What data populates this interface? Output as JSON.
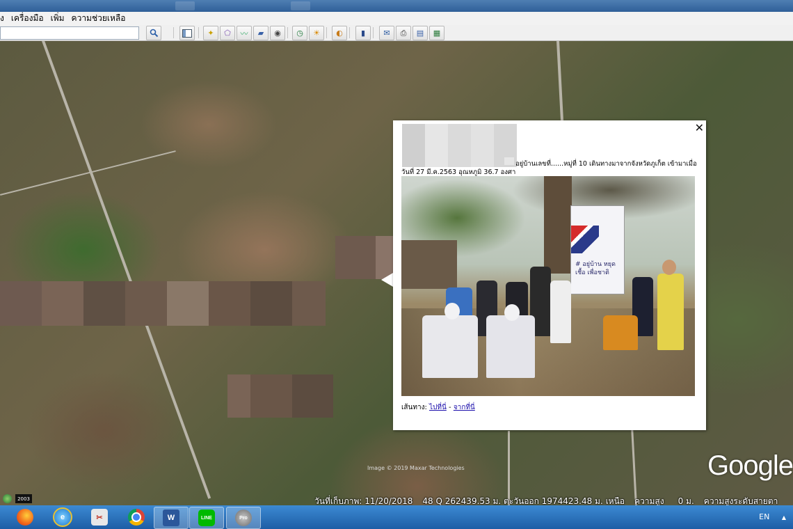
{
  "menu": {
    "items": [
      "ง",
      "เครื่องมือ",
      "เพิ่ม",
      "ความช่วยเหลือ"
    ]
  },
  "search": {
    "value": "",
    "placeholder": ""
  },
  "toolbar": {
    "icons": [
      "search-icon",
      "sidebar-icon",
      "placemark-icon",
      "polygon-icon",
      "path-icon",
      "overlay-icon",
      "tour-icon",
      "historical-imagery-icon",
      "sunlight-icon",
      "planets-icon",
      "ruler-icon",
      "email-icon",
      "print-icon",
      "save-image-icon",
      "view-maps-icon"
    ]
  },
  "balloon": {
    "line1": "อยู่บ้านเลขที่......หมู่ที่ 10 เดินทางมาจากจังหวัดภูเก็ต เข้ามาเมื่อ",
    "line2": "วันที่ 27 มี.ค.2563 อุณหภูมิ 36.7 องศา",
    "banner_text": "# อยู่บ้าน หยุดเชื้อ เพื่อชาติ",
    "route_label": "เส้นทาง:",
    "route_to": "ไปที่นี่",
    "route_sep": "-",
    "route_from": "จากที่นี่",
    "close_glyph": "✕"
  },
  "map": {
    "google_logo": "Google",
    "copyright": "Image © 2019 Maxar Technologies",
    "year_badge": "2003"
  },
  "status": {
    "date": "วันที่เก็บภาพ: 11/20/2018",
    "coords": "48 Q 262439.53 ม. ตะวันออก 1974423.48 ม. เหนือ",
    "elev_label": "ความสูง",
    "elev_value": "0 ม.",
    "eye_alt": "ความสูงระดับสายตา"
  },
  "taskbar": {
    "apps": [
      "firefox-icon",
      "internet-explorer-icon",
      "snipping-tool-icon",
      "chrome-icon",
      "word-icon",
      "line-icon",
      "google-earth-pro-icon"
    ],
    "word_letter": "W",
    "line_label": "LINE",
    "earth_label": "Pro",
    "lang": "EN",
    "tray_arrow": "▲"
  }
}
